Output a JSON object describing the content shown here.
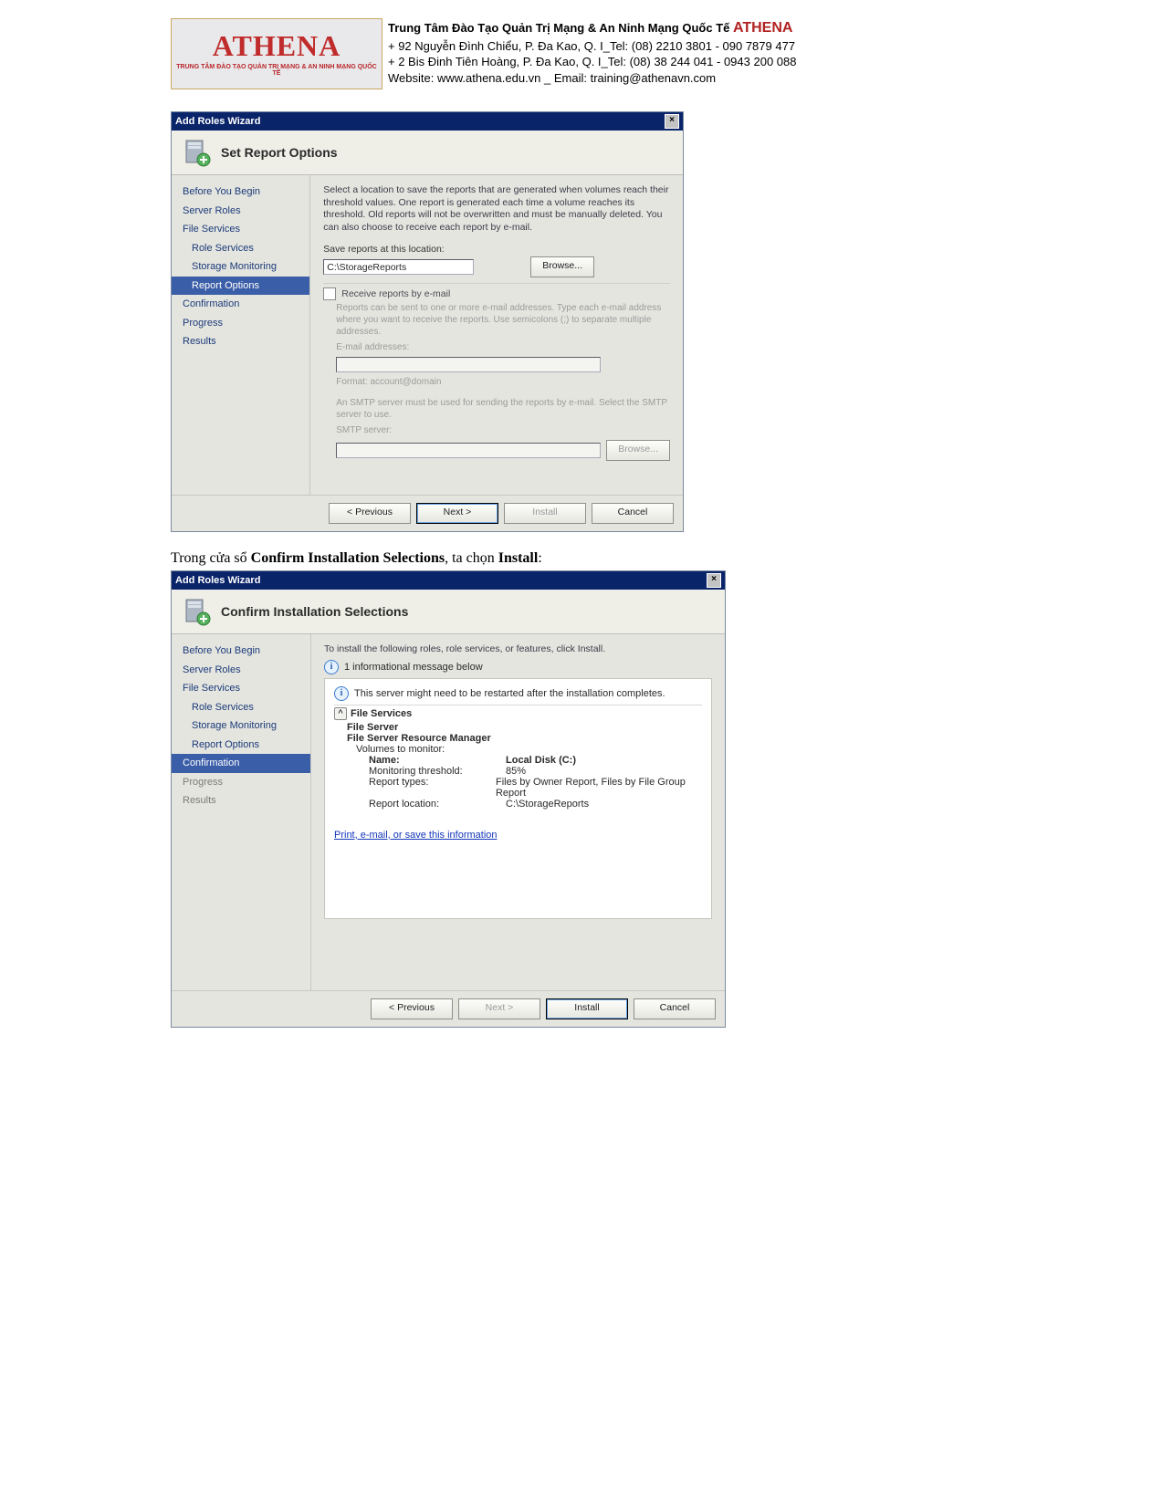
{
  "header": {
    "logo_main": "ATHENA",
    "logo_tag": "TRUNG TÂM ĐÀO TẠO QUẢN TRỊ MẠNG & AN NINH MẠNG QUỐC TẾ",
    "org_title_prefix": "Trung Tâm Đào Tạo Quản Trị Mạng & An Ninh Mạng Quốc Tế ",
    "org_brand": "ATHENA",
    "addr1": "+  92 Nguyễn Đình Chiểu, P. Đa Kao, Q. I_Tel: (08) 2210 3801 -  090 7879 477",
    "addr2": "+  2 Bis Đinh Tiên Hoàng, P. Đa Kao, Q. I_Tel: (08) 38 244 041 - 0943 200 088",
    "web_line": "Website: www.athena.edu.vn     _     Email: training@athenavn.com"
  },
  "wizard1": {
    "title": "Add Roles Wizard",
    "page_title": "Set Report Options",
    "sidebar": [
      {
        "label": "Before You Begin"
      },
      {
        "label": "Server Roles"
      },
      {
        "label": "File Services"
      },
      {
        "label": "Role Services",
        "indent": true
      },
      {
        "label": "Storage Monitoring",
        "indent": true
      },
      {
        "label": "Report Options",
        "indent": true,
        "selected": true
      },
      {
        "label": "Confirmation"
      },
      {
        "label": "Progress"
      },
      {
        "label": "Results"
      }
    ],
    "desc": "Select a location to save the reports that are generated when volumes reach their threshold values. One report is generated each time a volume reaches its threshold. Old reports will not be overwritten and must be manually deleted. You can also choose to receive each report by e-mail.",
    "save_label": "Save reports at this location:",
    "save_value": "C:\\StorageReports",
    "browse": "Browse...",
    "chk_label": "Receive reports by e-mail",
    "email_desc": "Reports can be sent to one or more e-mail addresses. Type each e-mail address where you want to receive the reports. Use semicolons (;) to separate multiple addresses.",
    "email_label": "E-mail addresses:",
    "format_hint": "Format: account@domain",
    "smtp_desc": "An SMTP server must be used for sending the reports by e-mail. Select the SMTP server to use.",
    "smtp_label": "SMTP server:",
    "footer": {
      "previous": "< Previous",
      "next": "Next >",
      "install": "Install",
      "cancel": "Cancel"
    }
  },
  "instruction": {
    "pre": "Trong cửa sổ ",
    "b1": "Confirm Installation Selections",
    "mid": ", ta chọn ",
    "b2": "Install",
    "suf": ":"
  },
  "wizard2": {
    "title": "Add Roles Wizard",
    "page_title": "Confirm Installation Selections",
    "sidebar": [
      {
        "label": "Before You Begin"
      },
      {
        "label": "Server Roles"
      },
      {
        "label": "File Services"
      },
      {
        "label": "Role Services",
        "indent": true
      },
      {
        "label": "Storage Monitoring",
        "indent": true
      },
      {
        "label": "Report Options",
        "indent": true
      },
      {
        "label": "Confirmation",
        "selected": true
      },
      {
        "label": "Progress",
        "grey": true
      },
      {
        "label": "Results",
        "grey": true
      }
    ],
    "desc": "To install the following roles, role services, or features, click Install.",
    "info_msg": "1 informational message below",
    "restart_msg": "This server might need to be restarted after the installation completes.",
    "group_title": "File Services",
    "subgroup1": "File Server",
    "subgroup2": "File Server Resource Manager",
    "vol_label": "Volumes to monitor:",
    "details": [
      {
        "k": "Name:",
        "v": "Local Disk (C:)",
        "bold": true
      },
      {
        "k": "Monitoring threshold:",
        "v": "85%"
      },
      {
        "k": "Report types:",
        "v": "Files by Owner Report, Files by File Group Report"
      },
      {
        "k": "Report location:",
        "v": "C:\\StorageReports"
      }
    ],
    "link": "Print, e-mail, or save this information",
    "footer": {
      "previous": "< Previous",
      "next": "Next >",
      "install": "Install",
      "cancel": "Cancel"
    }
  }
}
